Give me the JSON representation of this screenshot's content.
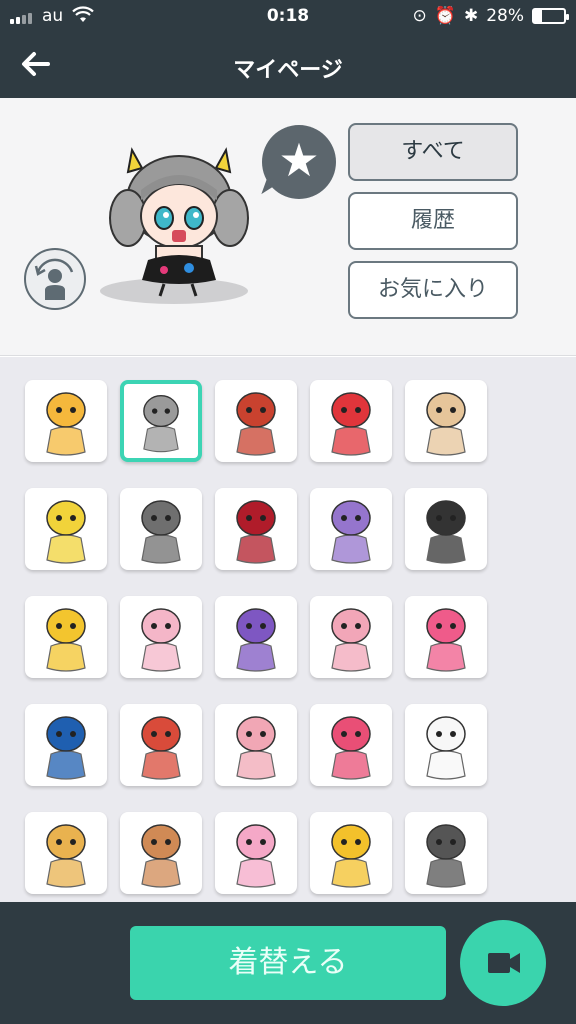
{
  "status_bar": {
    "carrier": "au",
    "time": "0:18",
    "battery": "28%",
    "battery_level": 0.28
  },
  "nav": {
    "title": "マイページ",
    "back_icon": "arrow-left-icon"
  },
  "filters": {
    "all": "すべて",
    "history": "履歴",
    "favorites": "お気に入り",
    "selected": "all"
  },
  "colors": {
    "header_bg": "#2f3b42",
    "accent": "#3ad4ad",
    "selected_border": "#3cd4b4",
    "grid_bg": "#eaeaef"
  },
  "stamps": [
    {
      "name": "tempura-chick"
    },
    {
      "name": "gray-hair-cat-ear-girl",
      "selected": true
    },
    {
      "name": "piyo-badge"
    },
    {
      "name": "red-daruma-chick"
    },
    {
      "name": "calico-cat"
    },
    {
      "name": "piyo-chick-green"
    },
    {
      "name": "shinigami"
    },
    {
      "name": "umbrella-girl"
    },
    {
      "name": "kimono-girl-longhair"
    },
    {
      "name": "black-hair-girl"
    },
    {
      "name": "yellow-robot"
    },
    {
      "name": "cat-girl-sign"
    },
    {
      "name": "banner-boy"
    },
    {
      "name": "cat-girl-cherry"
    },
    {
      "name": "cap-girl"
    },
    {
      "name": "baseball-boy"
    },
    {
      "name": "cat-girl-seabream"
    },
    {
      "name": "cat-girl-board"
    },
    {
      "name": "cat-girl-heart"
    },
    {
      "name": "white-cat-sign"
    },
    {
      "name": "cat-girl-scroll"
    },
    {
      "name": "fox-girl"
    },
    {
      "name": "pink-cat-girl"
    },
    {
      "name": "cat-girl-yellow-kimono"
    },
    {
      "name": "card-character"
    }
  ],
  "bottom": {
    "change_label": "着替える",
    "video_icon": "video-camera-icon"
  }
}
